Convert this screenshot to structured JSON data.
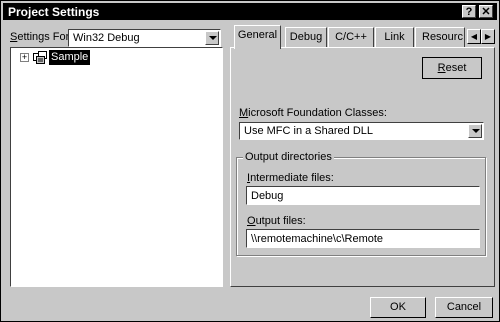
{
  "window": {
    "title": "Project Settings",
    "help_label": "?",
    "close_label": "✕"
  },
  "settings_for": {
    "label_u": "S",
    "label_rest": "ettings For:",
    "value": "Win32 Debug"
  },
  "tree": {
    "expander": "+",
    "items": [
      {
        "label": "Sample",
        "icon": "project-icon"
      }
    ]
  },
  "tabs": [
    {
      "label": "General",
      "active": true
    },
    {
      "label": "Debug"
    },
    {
      "label": "C/C++"
    },
    {
      "label": "Link"
    },
    {
      "label": "Resourc"
    }
  ],
  "tab_scroll": {
    "left": "◀",
    "right": "▶"
  },
  "reset": {
    "label_u": "R",
    "label_rest": "eset"
  },
  "mfc": {
    "label_u": "M",
    "label_rest": "icrosoft Foundation Classes:",
    "value": "Use MFC in a Shared DLL"
  },
  "output_dirs": {
    "group_label": "Output directories",
    "intermediate_label_u": "I",
    "intermediate_label_rest": "ntermediate files:",
    "intermediate_value": "Debug",
    "output_label_u": "O",
    "output_label_rest": "utput files:",
    "output_value": "\\\\remotemachine\\c\\Remote"
  },
  "buttons": {
    "ok": "OK",
    "cancel": "Cancel"
  }
}
